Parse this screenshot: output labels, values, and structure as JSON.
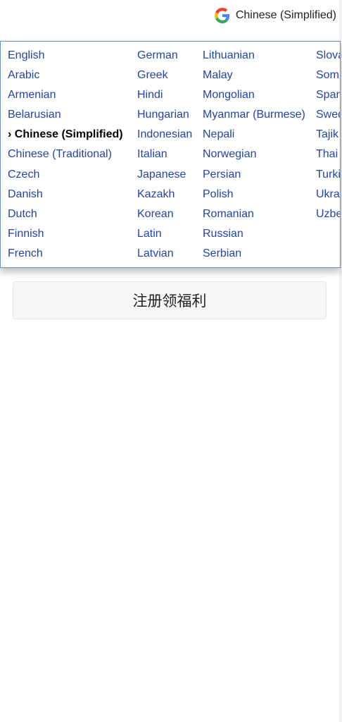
{
  "translate_widget": {
    "current_language": "Chinese (Simplified)",
    "icon": "google-g-icon",
    "selected_marker": "› "
  },
  "language_menu": {
    "columns": [
      [
        "English",
        "Arabic",
        "Armenian",
        "Belarusian",
        "Chinese (Simplified)",
        "Chinese (Traditional)",
        "Czech",
        "Danish",
        "Dutch",
        "Finnish",
        "French"
      ],
      [
        "German",
        "Greek",
        "Hindi",
        "Hungarian",
        "Indonesian",
        "Italian",
        "Japanese",
        "Kazakh",
        "Korean",
        "Latin",
        "Latvian"
      ],
      [
        "Lithuanian",
        "Malay",
        "Mongolian",
        "Myanmar (Burmese)",
        "Nepali",
        "Norwegian",
        "Persian",
        "Polish",
        "Romanian",
        "Russian",
        "Serbian"
      ],
      [
        "Slova",
        "Som",
        "Span",
        "Swed",
        "Tajik",
        "Thai",
        "Turki",
        "Ukra",
        "Uzbe"
      ]
    ],
    "selected": "Chinese (Simplified)",
    "link_color": "#2244aa"
  },
  "register_button": {
    "label": "注册领福利"
  }
}
